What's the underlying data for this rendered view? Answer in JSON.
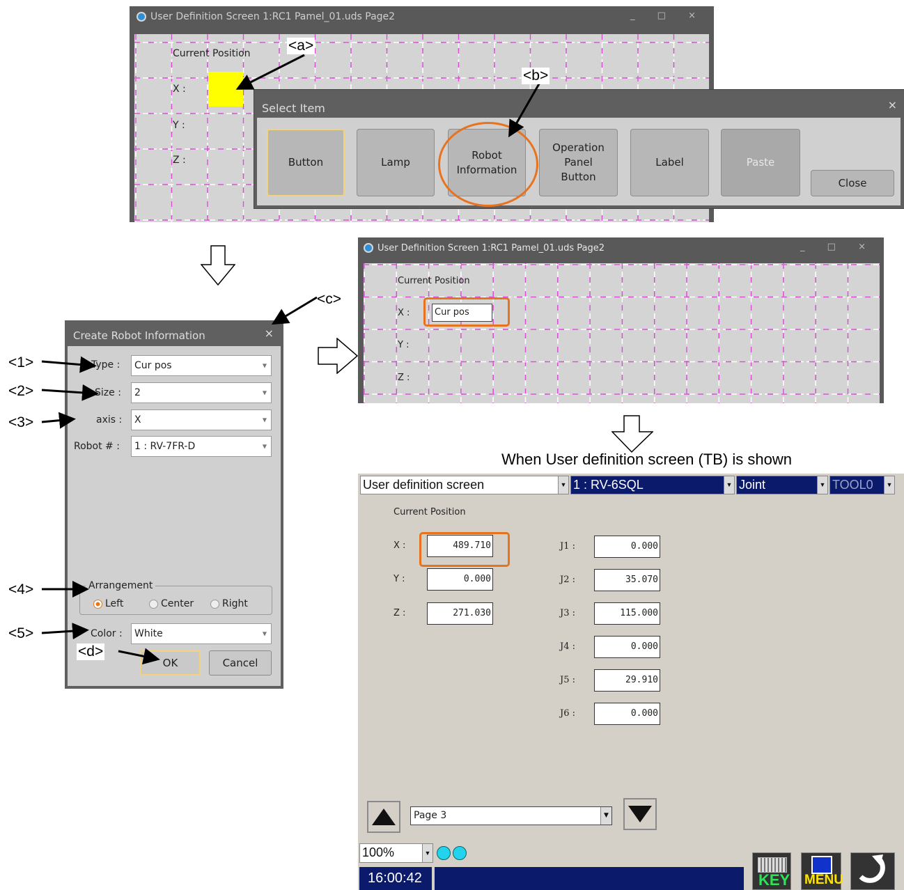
{
  "top_window": {
    "title": "User Definition Screen 1:RC1 Pamel_01.uds Page2",
    "window_controls": "_ □ ×",
    "labels": {
      "current_position": "Current Position",
      "x": "X :",
      "y": "Y :",
      "z": "Z :"
    }
  },
  "select_item": {
    "title": "Select Item",
    "close_x": "×",
    "buttons": [
      "Button",
      "Lamp",
      "Robot\nInformation",
      "Operation\nPanel\nButton",
      "Label",
      "Paste"
    ],
    "close_label": "Close"
  },
  "create_robot_info": {
    "title": "Create Robot Information",
    "close_x": "×",
    "type_label": "Type :",
    "type_value": "Cur pos",
    "size_label": "Size :",
    "size_value": "2",
    "axis_label": "axis :",
    "axis_value": "X",
    "robot_label": "Robot # :",
    "robot_value": "1 : RV-7FR-D",
    "arrangement_label": "Arrangement",
    "arrangement_options": [
      "Left",
      "Center",
      "Right"
    ],
    "arrangement_selected": "Left",
    "color_label": "Color :",
    "color_value": "White",
    "ok_label": "OK",
    "cancel_label": "Cancel"
  },
  "mid_window": {
    "title": "User Definition Screen 1:RC1 Pamel_01.uds Page2",
    "window_controls": "_ □ ×",
    "labels": {
      "current_position": "Current Position",
      "x": "X :",
      "y": "Y :",
      "z": "Z :"
    },
    "x_item_value": "Cur pos"
  },
  "callouts": {
    "a": "<a>",
    "b": "<b>",
    "c": "<c>",
    "d": "<d>",
    "n1": "<1>",
    "n2": "<2>",
    "n3": "<3>",
    "n4": "<4>",
    "n5": "<5>"
  },
  "tb_caption": "When User definition screen (TB) is shown",
  "tb": {
    "screen_select": "User definition screen",
    "robot_select": "1 : RV-6SQL",
    "mode_select": "Joint",
    "tool_select": "TOOL0",
    "current_position_label": "Current Position",
    "xyz": [
      {
        "label": "X :",
        "value": "489.710"
      },
      {
        "label": "Y :",
        "value": "0.000"
      },
      {
        "label": "Z :",
        "value": "271.030"
      }
    ],
    "joints": [
      {
        "label": "J1 :",
        "value": "0.000"
      },
      {
        "label": "J2 :",
        "value": "35.070"
      },
      {
        "label": "J3 :",
        "value": "115.000"
      },
      {
        "label": "J4 :",
        "value": "0.000"
      },
      {
        "label": "J5 :",
        "value": "29.910"
      },
      {
        "label": "J6 :",
        "value": "0.000"
      }
    ],
    "page_select": "Page 3",
    "zoom": "100%",
    "time": "16:00:42",
    "key_label": "KEY",
    "menu_label": "MENU"
  },
  "colors": {
    "accent_orange": "#e8731e",
    "grid_magenta": "#d84cd8",
    "tb_navy": "#0b1a6b",
    "yellow_item": "#ffff00"
  }
}
